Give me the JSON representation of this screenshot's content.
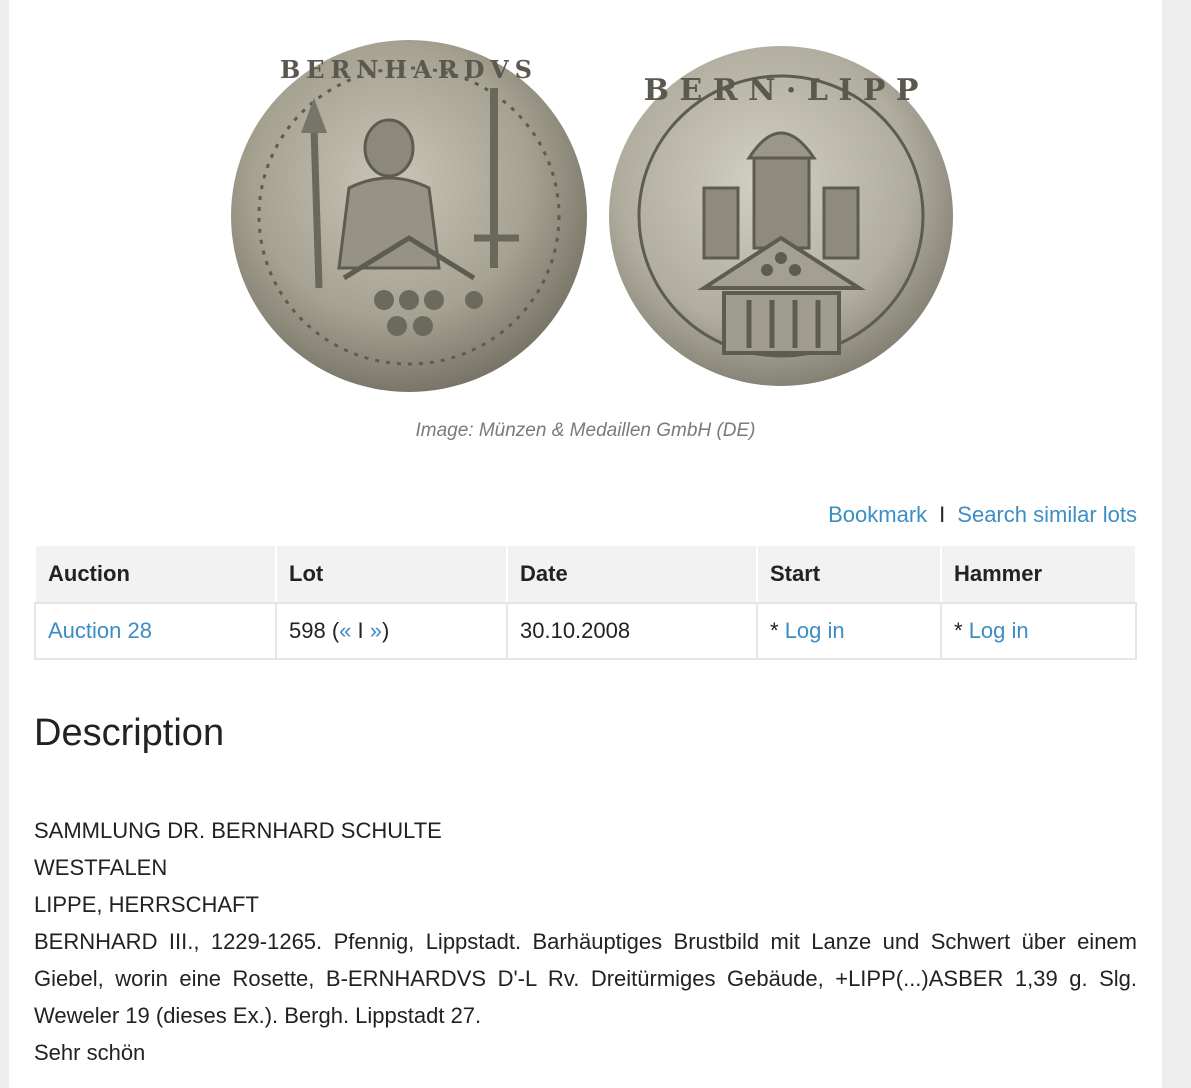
{
  "image": {
    "caption": "Image: Münzen & Medaillen GmbH (DE)",
    "obverse_legend": "BERNHARDVS",
    "reverse_legend": "B E R N · L I P P"
  },
  "actions": {
    "bookmark": "Bookmark",
    "separator": "I",
    "search_similar": "Search similar lots"
  },
  "table": {
    "headers": {
      "auction": "Auction",
      "lot": "Lot",
      "date": "Date",
      "start": "Start",
      "hammer": "Hammer"
    },
    "row": {
      "auction": "Auction 28",
      "lot_number": "598 (",
      "prev": "«",
      "divider": " I ",
      "next": "»",
      "lot_close": ")",
      "date": "30.10.2008",
      "start_prefix": "* ",
      "start_login": "Log in",
      "hammer_prefix": "* ",
      "hammer_login": "Log in"
    }
  },
  "description": {
    "title": "Description",
    "line1": "SAMMLUNG DR. BERNHARD SCHULTE",
    "line2": "WESTFALEN",
    "line3": "LIPPE, HERRSCHAFT",
    "line4": "BERNHARD III., 1229-1265. Pfennig, Lippstadt. Barhäuptiges Brustbild mit Lanze und Schwert über einem Giebel, worin eine Rosette, B-ERNHARDVS D'-L Rv. Dreitürmiges Gebäude, +LIPP(...)ASBER 1,39 g. Slg. Weweler 19 (dieses Ex.). Bergh. Lippstadt 27.",
    "line5": "Sehr schön"
  }
}
